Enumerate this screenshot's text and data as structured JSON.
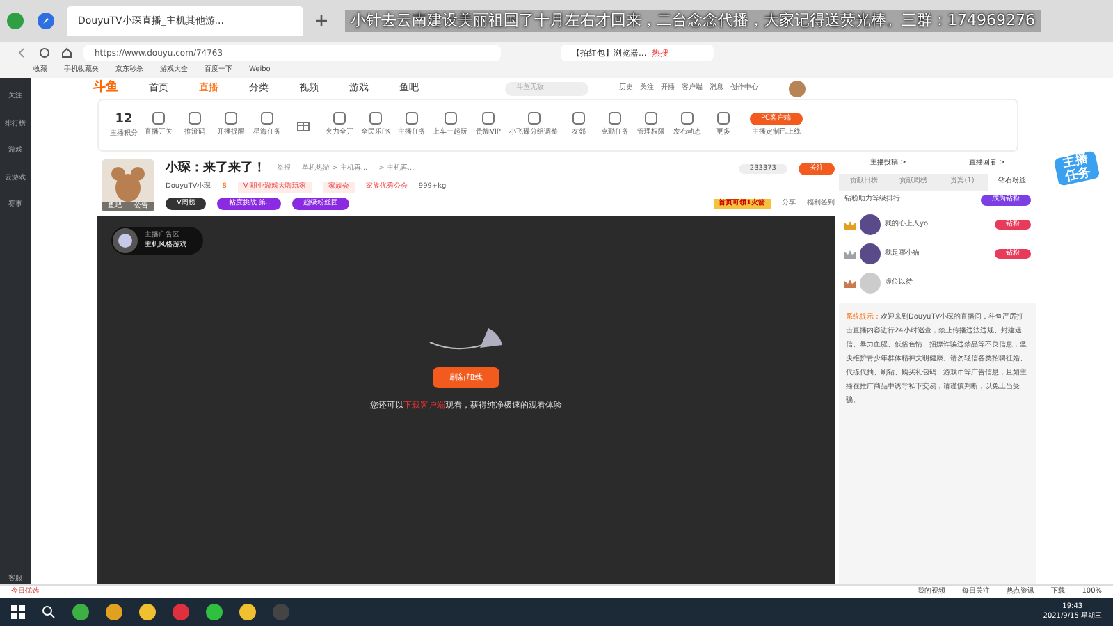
{
  "browser": {
    "tab_title": "DouyuTV小琛直播_主机其他游...",
    "overlay_text": "小针去云南建设美丽祖国了十月左右才回来，二台念念代播，大家记得送荧光棒。三群：174969276",
    "url": "https://www.douyu.com/74763",
    "search_text": "【拍红包】浏览器...",
    "search_badge": "热搜",
    "bookmarks": [
      "收藏",
      "手机收藏夹",
      "京东秒杀",
      "游戏大全",
      "百度一下",
      "Weibo"
    ]
  },
  "site_nav": {
    "logo": "斗鱼",
    "items": [
      {
        "label": "首页",
        "selected": false
      },
      {
        "label": "直播",
        "selected": true
      },
      {
        "label": "分类",
        "selected": false
      },
      {
        "label": "视频",
        "selected": false
      },
      {
        "label": "游戏",
        "selected": false
      },
      {
        "label": "鱼吧",
        "selected": false
      }
    ],
    "search_placeholder": "斗鱼无敌",
    "user_icons": [
      "历史",
      "关注",
      "开播",
      "客户端",
      "消息",
      "创作中心"
    ]
  },
  "sidebar": [
    "关注",
    "排行榜",
    "游戏",
    "云游戏",
    "赛事",
    "客服"
  ],
  "toolbar": {
    "score": "12",
    "score_label": "主播积分",
    "items": [
      {
        "kind": "labeled",
        "label": "直播开关"
      },
      {
        "kind": "labeled",
        "label": "推流码"
      },
      {
        "kind": "labeled",
        "label": "开播提醒"
      },
      {
        "kind": "labeled",
        "label": "星海任务"
      },
      {
        "kind": "gift"
      },
      {
        "kind": "labeled",
        "label": "火力全开"
      },
      {
        "kind": "labeled",
        "label": "全民乐PK"
      },
      {
        "kind": "labeled",
        "label": "主播任务"
      },
      {
        "kind": "labeled",
        "label": "上车一起玩"
      },
      {
        "kind": "labeled",
        "label": "贵族VIP"
      },
      {
        "kind": "labeled",
        "label": "小飞碟分组调整"
      },
      {
        "kind": "labeled",
        "label": "友邻"
      },
      {
        "kind": "labeled",
        "label": "克勤任务"
      },
      {
        "kind": "labeled",
        "label": "管理权限"
      },
      {
        "kind": "labeled",
        "label": "发布动态"
      },
      {
        "kind": "labeled",
        "label": "更多"
      }
    ],
    "client_button": "PC客户端",
    "client_note": "主播定制已上线"
  },
  "streamer": {
    "title": "小琛：来了来了！",
    "report": "举报",
    "category": "单机热游 > 主机再...",
    "subcategory": "> 主机再...",
    "name": "DouyuTV小琛",
    "level": "8",
    "badge": "V 职业游戏大咖玩家",
    "guild": "家族会",
    "guild_note": "家族优秀公会",
    "weight": "999+kg",
    "tags": [
      "V周榜",
      "粘度挑战 第..",
      "超级粉丝团"
    ],
    "avatar_labels": [
      "鱼吧",
      "公告"
    ],
    "hot": "233373",
    "follow": "关注",
    "promo": "首页可领1火箭",
    "actions": [
      "分享",
      "福利签到"
    ]
  },
  "player": {
    "ad_top": "主播广告区",
    "ad_name": "主机风格游戏",
    "reload": "刷新加载",
    "tip_before": "您还可以",
    "tip_link": "下载客户端",
    "tip_after": "观看，获得纯净极速的观看体验"
  },
  "panel": {
    "links": [
      "主播投稿 >",
      "直播回看 >"
    ],
    "tabs": [
      {
        "label": "贡献日榜",
        "selected": false
      },
      {
        "label": "贡献周榜",
        "selected": false
      },
      {
        "label": "贵宾(1)",
        "selected": false
      },
      {
        "label": "钻石粉丝",
        "selected": true
      }
    ],
    "rank_title": "钻粉助力等级排行",
    "rank_button": "成为钻粉",
    "ranks": [
      {
        "name": "我的心上人yo",
        "color": "#e0a020",
        "badge": "钻粉"
      },
      {
        "name": "我是哪小猫",
        "color": "#a0a0a8",
        "badge": "钻粉"
      },
      {
        "name": "虚位以待",
        "color": "#c87a50"
      }
    ],
    "notice_label": "系统提示：",
    "notice": "欢迎来到DouyuTV小琛的直播间，斗鱼严厉打击直播内容进行24小时巡查，禁止传播违法违规、封建迷信、暴力血腥、低俗色情、招嫖诈骗违禁品等不良信息，坚决维护青少年群体精神文明健康。请勿轻信各类招聘征婚、代练代抽、刷钻、购买礼包码、游戏币等广告信息，且如主播在推广商品中诱导私下交易，请谨慎判断，以免上当受骗。",
    "task_badge": "主播任务"
  },
  "status_bar": {
    "left": "今日优选",
    "items": [
      "我的视频",
      "每日关注",
      "热点资讯",
      "下载"
    ],
    "zoom": "100%"
  },
  "taskbar": {
    "time": "19:43",
    "date": "2021/9/15 星期三"
  }
}
